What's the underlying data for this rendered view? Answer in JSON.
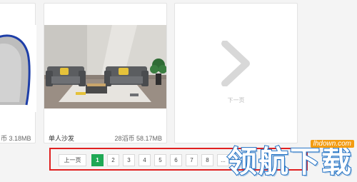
{
  "cards": {
    "left": {
      "meta": "币 3.18MB"
    },
    "middle": {
      "title": "单人沙发",
      "meta": "28滔币  58.17MB"
    },
    "next": {
      "label": "下一页"
    }
  },
  "pagination": {
    "prev_label": "上一页",
    "pages": [
      "1",
      "2",
      "3",
      "4",
      "5",
      "6",
      "7",
      "8",
      "..."
    ],
    "active_page": "1"
  },
  "watermark": {
    "url": "lhdown.com",
    "text": "领航下载"
  },
  "colors": {
    "accent": "#1fa955",
    "highlight_border": "#e02020"
  }
}
